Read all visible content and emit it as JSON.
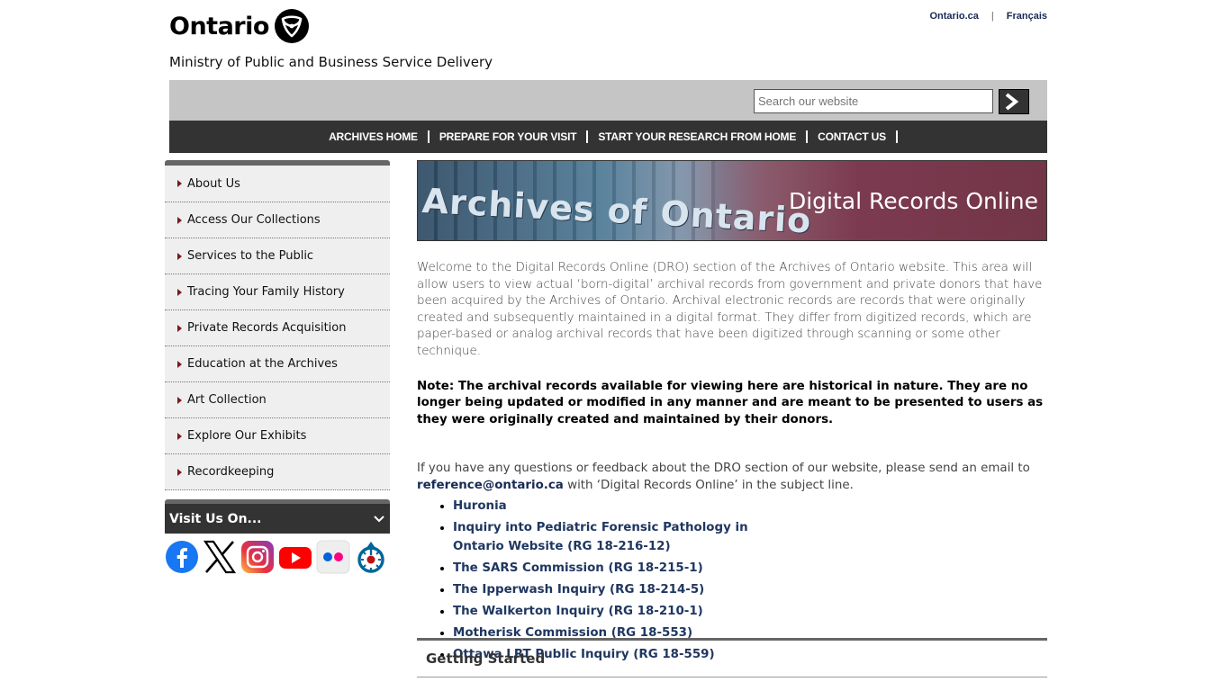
{
  "header": {
    "brand": "Ontario",
    "ministry": "Ministry of Public and Business Service Delivery",
    "util_links": [
      "Ontario.ca",
      "Français"
    ]
  },
  "search": {
    "placeholder": "Search our website",
    "value": "Search our website"
  },
  "topnav": [
    "ARCHIVES HOME",
    "PREPARE FOR YOUR VISIT",
    "START YOUR RESEARCH FROM HOME",
    "CONTACT US"
  ],
  "sidebar": {
    "items": [
      "About Us",
      "Access Our Collections",
      "Services to the Public",
      "Tracing Your Family History",
      "Private Records Acquisition",
      "Education at the Archives",
      "Art Collection",
      "Explore Our Exhibits",
      "Recordkeeping"
    ],
    "visit_label": "Visit Us On...",
    "social_icons": [
      "facebook-icon",
      "x-icon",
      "instagram-icon",
      "youtube-icon",
      "flickr-icon",
      "wikimedia-commons-icon"
    ]
  },
  "banner": {
    "image_text": "Archives of Ontario",
    "title": "Digital Records Online"
  },
  "main": {
    "intro": "Welcome to the Digital Records Online (DRO) section of the Archives of Ontario website. This area will allow users to view actual ‘born-digital’ archival records from government and private donors that have been acquired by the Archives of Ontario. Archival electronic records are records that were originally created and subsequently maintained in a digital format. They differ from digitized records, which are paper-based or analog archival records that have been digitized through scanning or some other technique.",
    "note": "Note: The archival records available for viewing here are historical in nature. They are no longer being updated or modified in any manner and are meant to be presented to users as they were originally created and maintained by their donors.",
    "feedback_prefix": "If you have any questions or feedback about the DRO section of our website, please send an email to",
    "feedback_email": "reference@ontario.ca",
    "feedback_suffix": "with ‘Digital Records Online’ in the subject line.",
    "links": [
      "Huronia",
      "Inquiry into Pediatric Forensic Pathology in Ontario Website (RG 18-216-12)",
      "The SARS Commission (RG 18-215-1)",
      "The Ipperwash Inquiry (RG 18-214-5)",
      "The Walkerton Inquiry (RG 18-210-1)",
      "Motherisk Commission (RG 18-553)",
      "Ottawa LRT Public Inquiry (RG 18-559)"
    ],
    "section_heading": "Getting Started"
  },
  "colors": {
    "nav_bg": "#333333",
    "link": "#1f3760",
    "caret": "#7a1a1a",
    "search_bar_bg": "#c5c5c5"
  }
}
